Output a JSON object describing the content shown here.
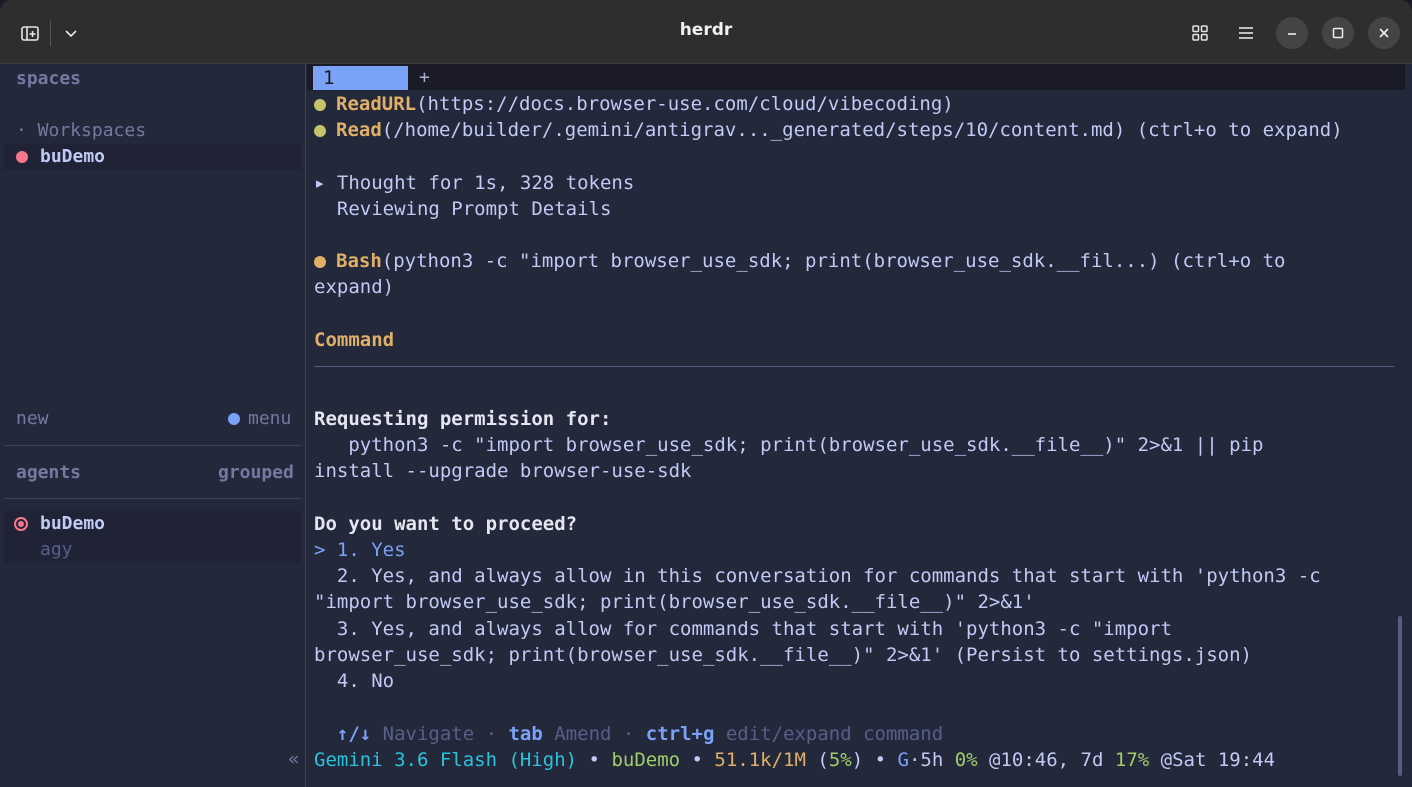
{
  "window": {
    "title": "herdr",
    "colors": {
      "titlebar": "#2e2e2e",
      "background": "#24283b",
      "accent": "#7aa2f7",
      "yellow": "#e0af68",
      "green": "#9ece6a",
      "pink": "#f7768e"
    }
  },
  "sidebar": {
    "spaces_heading": "spaces",
    "workspaces_label": "· Workspaces",
    "current_space": "buDemo",
    "new_label": "new",
    "menu_label": "menu",
    "agents_heading": "agents",
    "grouped_label": "grouped",
    "agent_name": "buDemo",
    "agent_sub": "agy",
    "collapse_glyph": "«"
  },
  "tabs": {
    "active_label": "1",
    "add_label": "+"
  },
  "terminal": {
    "l1_name": "ReadURL",
    "l1_args": "(https://docs.browser-use.com/cloud/vibecoding)",
    "l2_name": "Read",
    "l2_args": "(/home/builder/.gemini/antigrav..._generated/steps/10/content.md) (ctrl+o to expand)",
    "thought_line": "▸ Thought for 1s, 328 tokens",
    "thought_sub": "  Reviewing Prompt Details",
    "bash_name": "Bash",
    "bash_args": "(python3 -c \"import browser_use_sdk; print(browser_use_sdk.__fil...) (ctrl+o to",
    "bash_wrap": "expand)",
    "command_heading": "Command",
    "permission_heading": "Requesting permission for:",
    "cmd_line1": "   python3 -c \"import browser_use_sdk; print(browser_use_sdk.__file__)\" 2>&1 || pip",
    "cmd_line2": "install --upgrade browser-use-sdk",
    "question": "Do you want to proceed?",
    "opt1": "> 1. Yes",
    "opt2a": "  2. Yes, and always allow in this conversation for commands that start with 'python3 -c",
    "opt2b": "\"import browser_use_sdk; print(browser_use_sdk.__file__)\" 2>&1'",
    "opt3a": "  3. Yes, and always allow for commands that start with 'python3 -c \"import",
    "opt3b": "browser_use_sdk; print(browser_use_sdk.__file__)\" 2>&1' (Persist to settings.json)",
    "opt4": "  4. No",
    "hint_nav_key": "  ↑/↓",
    "hint_nav": " Navigate · ",
    "hint_tab_key": "tab",
    "hint_tab": " Amend · ",
    "hint_ctrl_key": "ctrl+g",
    "hint_ctrl": " edit/expand command"
  },
  "status": {
    "model": "Gemini 3.6 Flash (High)",
    "sep1": " • ",
    "space": "buDemo",
    "sep2": " • ",
    "tokens": "51.1k/1M",
    "paren_open": " (",
    "pct": "5%",
    "paren_close": ")",
    "sep3": " • ",
    "g_label": "G",
    "g_rest": "·5h ",
    "g_pct": "0%",
    "at1": " @10:46, 7d ",
    "pct7d": "17%",
    "at2": " @Sat 19:44"
  }
}
